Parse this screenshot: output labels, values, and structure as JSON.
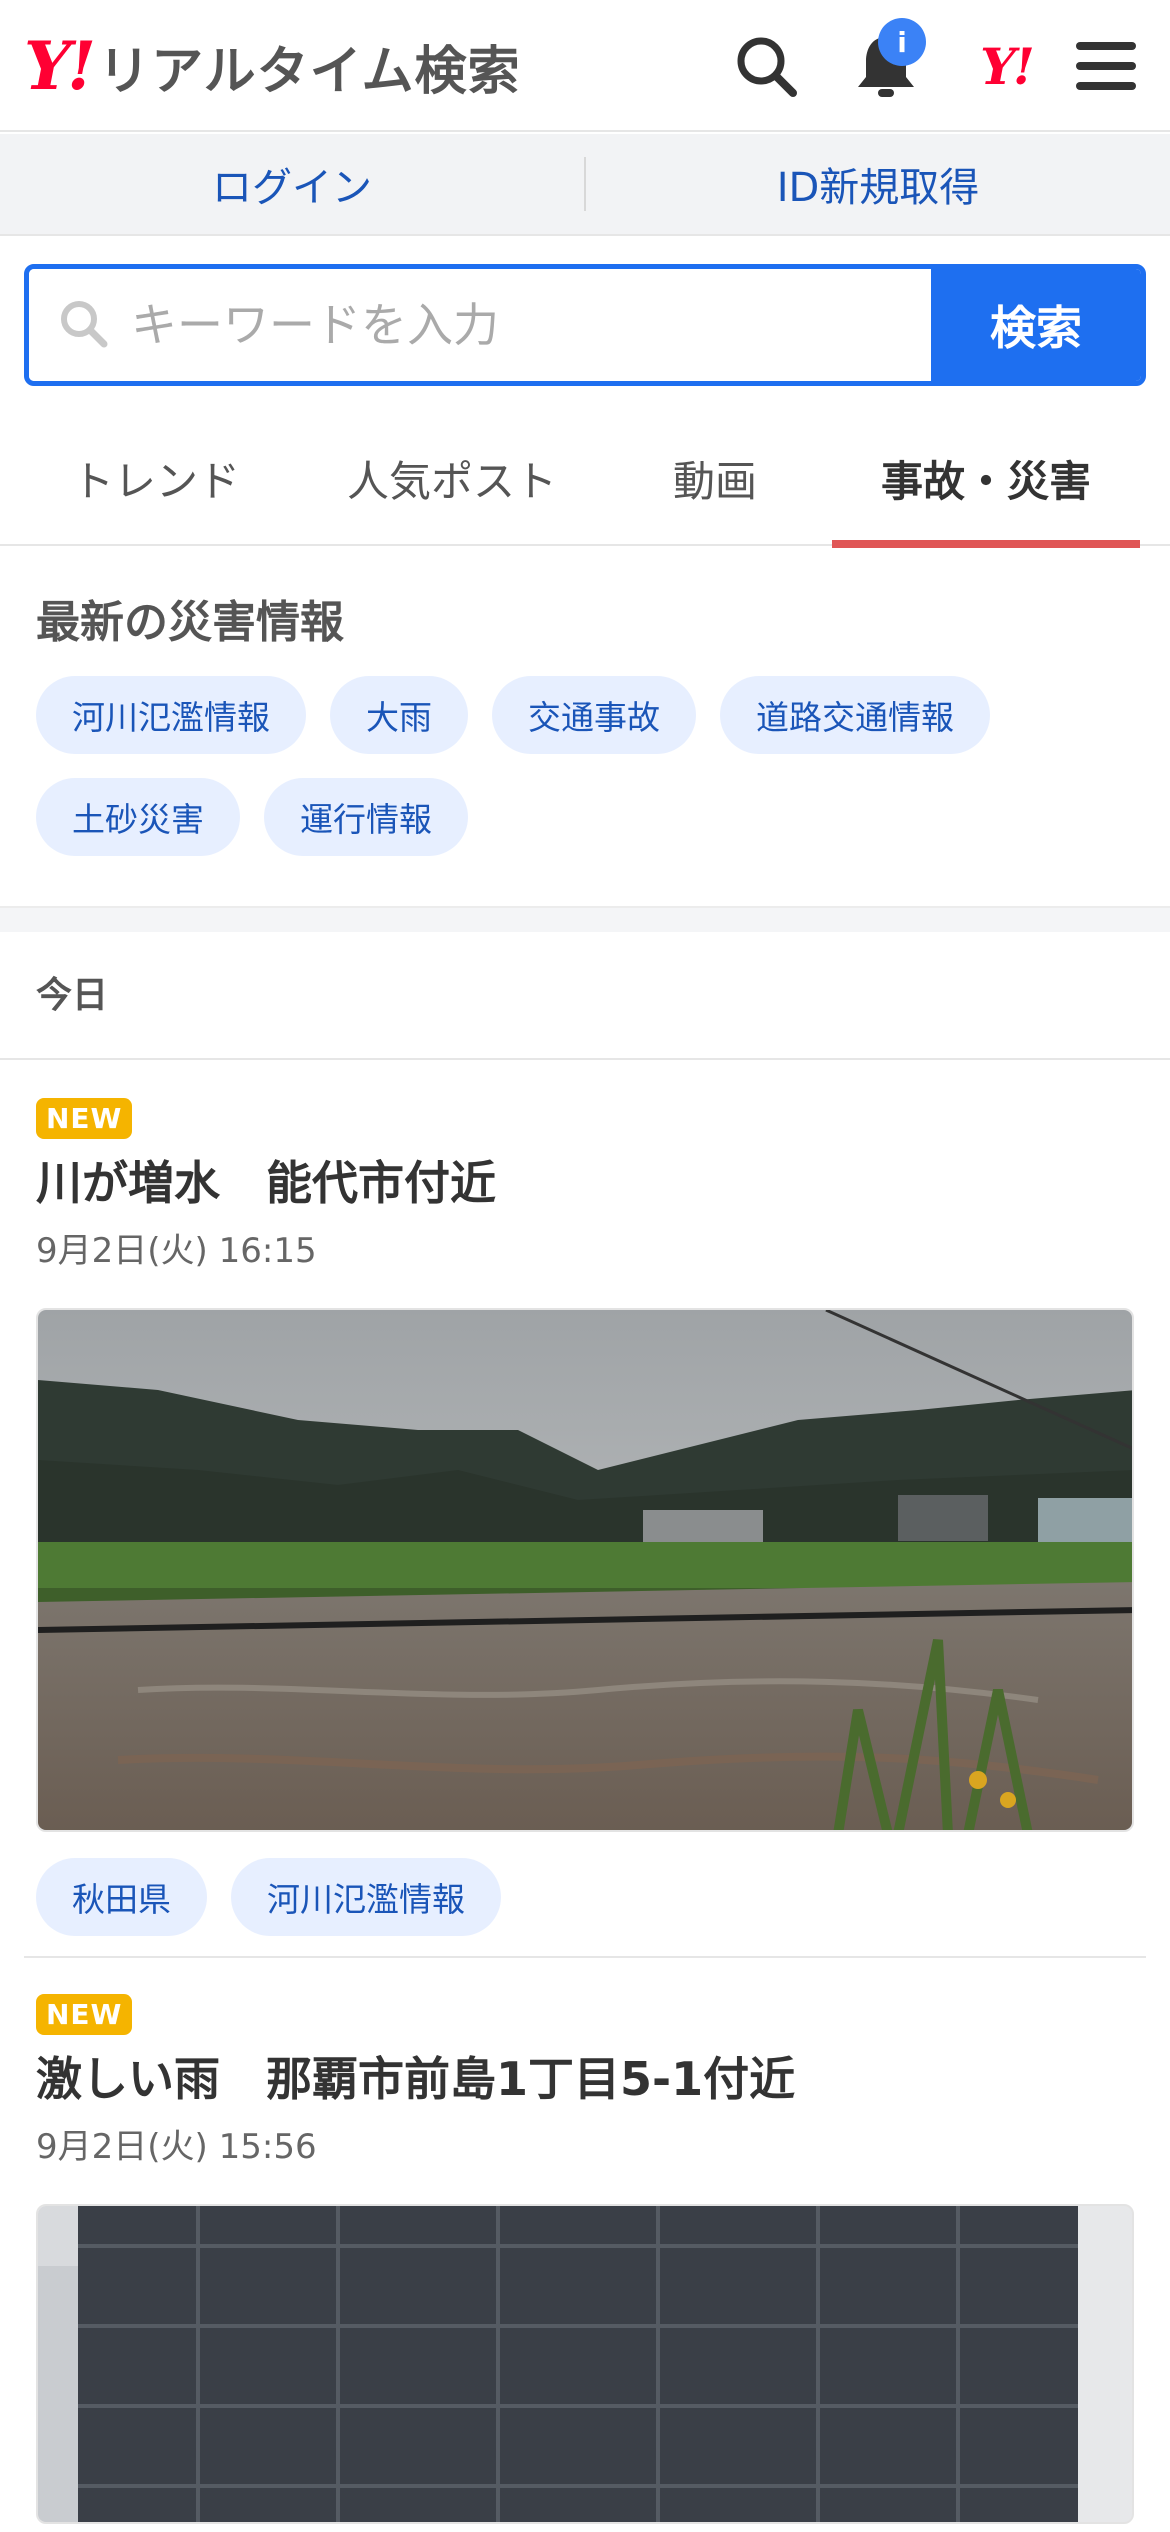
{
  "header": {
    "logo_mark": "Y!",
    "logo_text": "リアルタイム検索",
    "notification_badge": "i",
    "yahoo_mark": "Y!"
  },
  "account": {
    "login": "ログイン",
    "signup": "ID新規取得"
  },
  "search": {
    "placeholder": "キーワードを入力",
    "button": "検索"
  },
  "tabs": [
    {
      "label": "トレンド"
    },
    {
      "label": "人気ポスト"
    },
    {
      "label": "動画"
    },
    {
      "label": "事故・災害",
      "active": true
    }
  ],
  "disaster": {
    "title": "最新の災害情報",
    "chips": [
      "河川氾濫情報",
      "大雨",
      "交通事故",
      "道路交通情報",
      "土砂災害",
      "運行情報"
    ]
  },
  "feed": {
    "day_label": "今日",
    "posts": [
      {
        "badge": "NEW",
        "title": "川が増水　能代市付近",
        "time": "9月2日(火) 16:15",
        "tags": [
          "秋田県",
          "河川氾濫情報"
        ]
      },
      {
        "badge": "NEW",
        "title": "激しい雨　那覇市前島1丁目5-1付近",
        "time": "9月2日(火) 15:56",
        "tags": []
      }
    ]
  },
  "colors": {
    "brand_red": "#ff0033",
    "accent_blue": "#1e6ff0",
    "link_blue": "#1a55b8",
    "tab_underline": "#e05656",
    "new_badge": "#f5b400"
  }
}
